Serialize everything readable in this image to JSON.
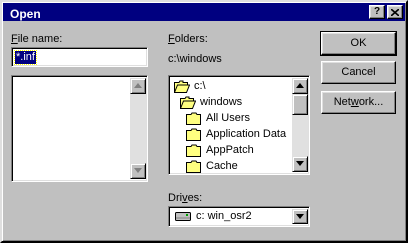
{
  "window": {
    "title": "Open"
  },
  "titlebar_buttons": {
    "help": "?",
    "close": "X"
  },
  "file_name": {
    "label_u": "F",
    "label_rest": "ile name:",
    "value": "*.inf"
  },
  "folders": {
    "label_u": "F",
    "label_rest": "olders:",
    "current_path": "c:\\windows",
    "items": [
      {
        "label": "c:\\",
        "icon": "open-folder-icon"
      },
      {
        "label": "windows",
        "icon": "open-folder-icon"
      },
      {
        "label": "All Users",
        "icon": "folder-icon"
      },
      {
        "label": "Application Data",
        "icon": "folder-icon"
      },
      {
        "label": "AppPatch",
        "icon": "folder-icon"
      },
      {
        "label": "Cache",
        "icon": "folder-icon"
      }
    ]
  },
  "drives": {
    "label_u": "v",
    "label_pre": "Dri",
    "label_post": "es:",
    "value": "c: win_osr2",
    "icon": "hard-drive-icon"
  },
  "buttons": {
    "ok": "OK",
    "cancel": "Cancel",
    "network_u": "w",
    "network_pre": "Net",
    "network_post": "ork..."
  },
  "colors": {
    "titlebar": "#000080",
    "face": "#c0c0c0",
    "selection": "#000080",
    "folder": "#ffff80"
  }
}
